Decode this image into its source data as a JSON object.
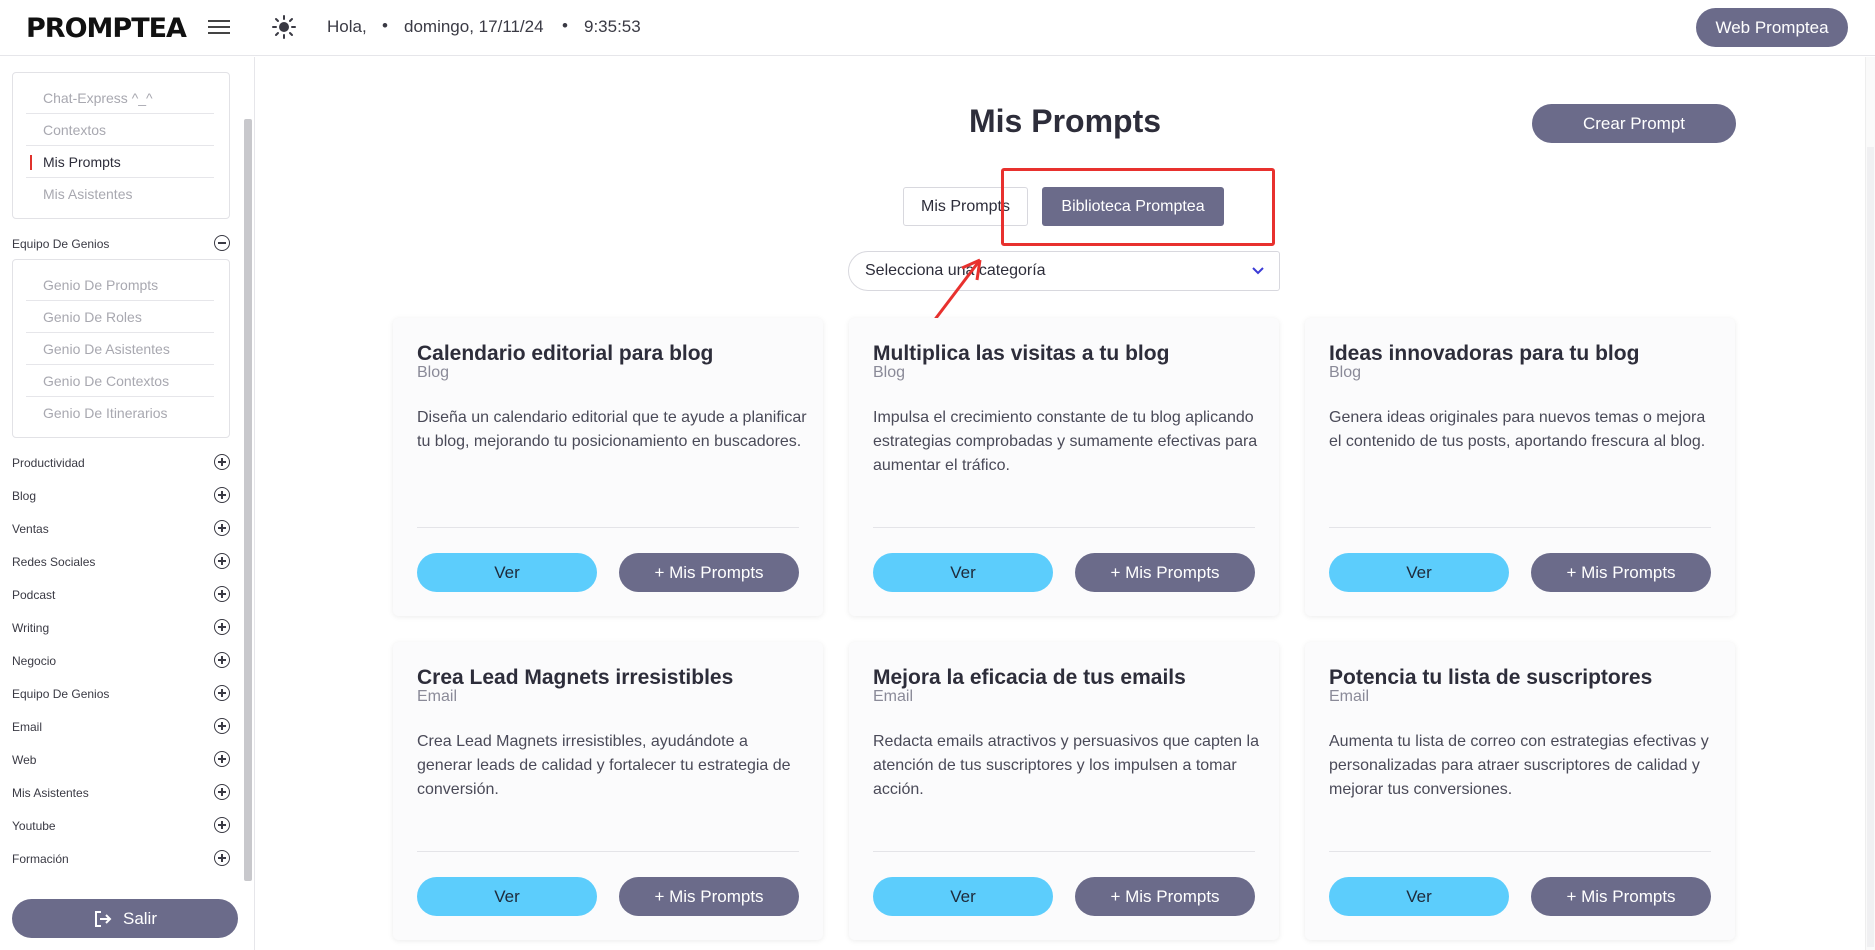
{
  "header": {
    "logo": "PROMPTEA",
    "greeting": "Hola,",
    "date": "domingo, 17/11/24",
    "time": "9:35:53",
    "web_button": "Web Promptea"
  },
  "sidebar": {
    "top_menu": [
      "Chat-Express ^_^",
      "Contextos",
      "Mis Prompts",
      "Mis Asistentes"
    ],
    "active_item": "Mis Prompts",
    "expanded_section": "Equipo De Genios",
    "genios": [
      "Genio De Prompts",
      "Genio De Roles",
      "Genio De Asistentes",
      "Genio De Contextos",
      "Genio De Itinerarios"
    ],
    "sections": [
      "Productividad",
      "Blog",
      "Ventas",
      "Redes Sociales",
      "Podcast",
      "Writing",
      "Negocio",
      "Equipo De Genios",
      "Email",
      "Web",
      "Mis Asistentes",
      "Youtube",
      "Formación"
    ],
    "logout": "Salir"
  },
  "main": {
    "title": "Mis Prompts",
    "create_button": "Crear Prompt",
    "tabs": [
      "Mis Prompts",
      "Biblioteca Promptea"
    ],
    "selected_tab": "Biblioteca Promptea",
    "category_select": "Selecciona una categoría",
    "cards": [
      {
        "title": "Calendario editorial para blog",
        "category": "Blog",
        "desc": "Diseña un calendario editorial que te ayude a planificar tu blog, mejorando tu posicionamiento en buscadores.",
        "view": "Ver",
        "add": "+ Mis Prompts"
      },
      {
        "title": "Multiplica las visitas a tu blog",
        "category": "Blog",
        "desc": "Impulsa el crecimiento constante de tu blog aplicando estrategias comprobadas y sumamente efectivas para aumentar el tráfico.",
        "view": "Ver",
        "add": "+ Mis Prompts"
      },
      {
        "title": "Ideas innovadoras para tu blog",
        "category": "Blog",
        "desc": "Genera ideas originales para nuevos temas o mejora el contenido de tus posts, aportando frescura al blog.",
        "view": "Ver",
        "add": "+ Mis Prompts"
      },
      {
        "title": "Crea Lead Magnets irresistibles",
        "category": "Email",
        "desc": "Crea Lead Magnets irresistibles, ayudándote a generar leads de calidad y fortalecer tu estrategia de conversión.",
        "view": "Ver",
        "add": "+ Mis Prompts"
      },
      {
        "title": "Mejora la eficacia de tus emails",
        "category": "Email",
        "desc": "Redacta emails atractivos y persuasivos que capten la atención de tus suscriptores y los impulsen a tomar acción.",
        "view": "Ver",
        "add": "+ Mis Prompts"
      },
      {
        "title": "Potencia tu lista de suscriptores",
        "category": "Email",
        "desc": "Aumenta tu lista de correo con estrategias efectivas y personalizadas para atraer suscriptores de calidad y mejorar tus conversiones.",
        "view": "Ver",
        "add": "+ Mis Prompts"
      }
    ]
  },
  "colors": {
    "accent": "#6b6b8a",
    "view_button": "#5ccdfc",
    "annotation": "#e8312e",
    "active_marker": "#e0322c"
  },
  "icons": [
    "hamburger-icon",
    "sun-icon",
    "chevron-down-icon",
    "plus-circle-icon",
    "minus-circle-icon",
    "logout-icon"
  ]
}
